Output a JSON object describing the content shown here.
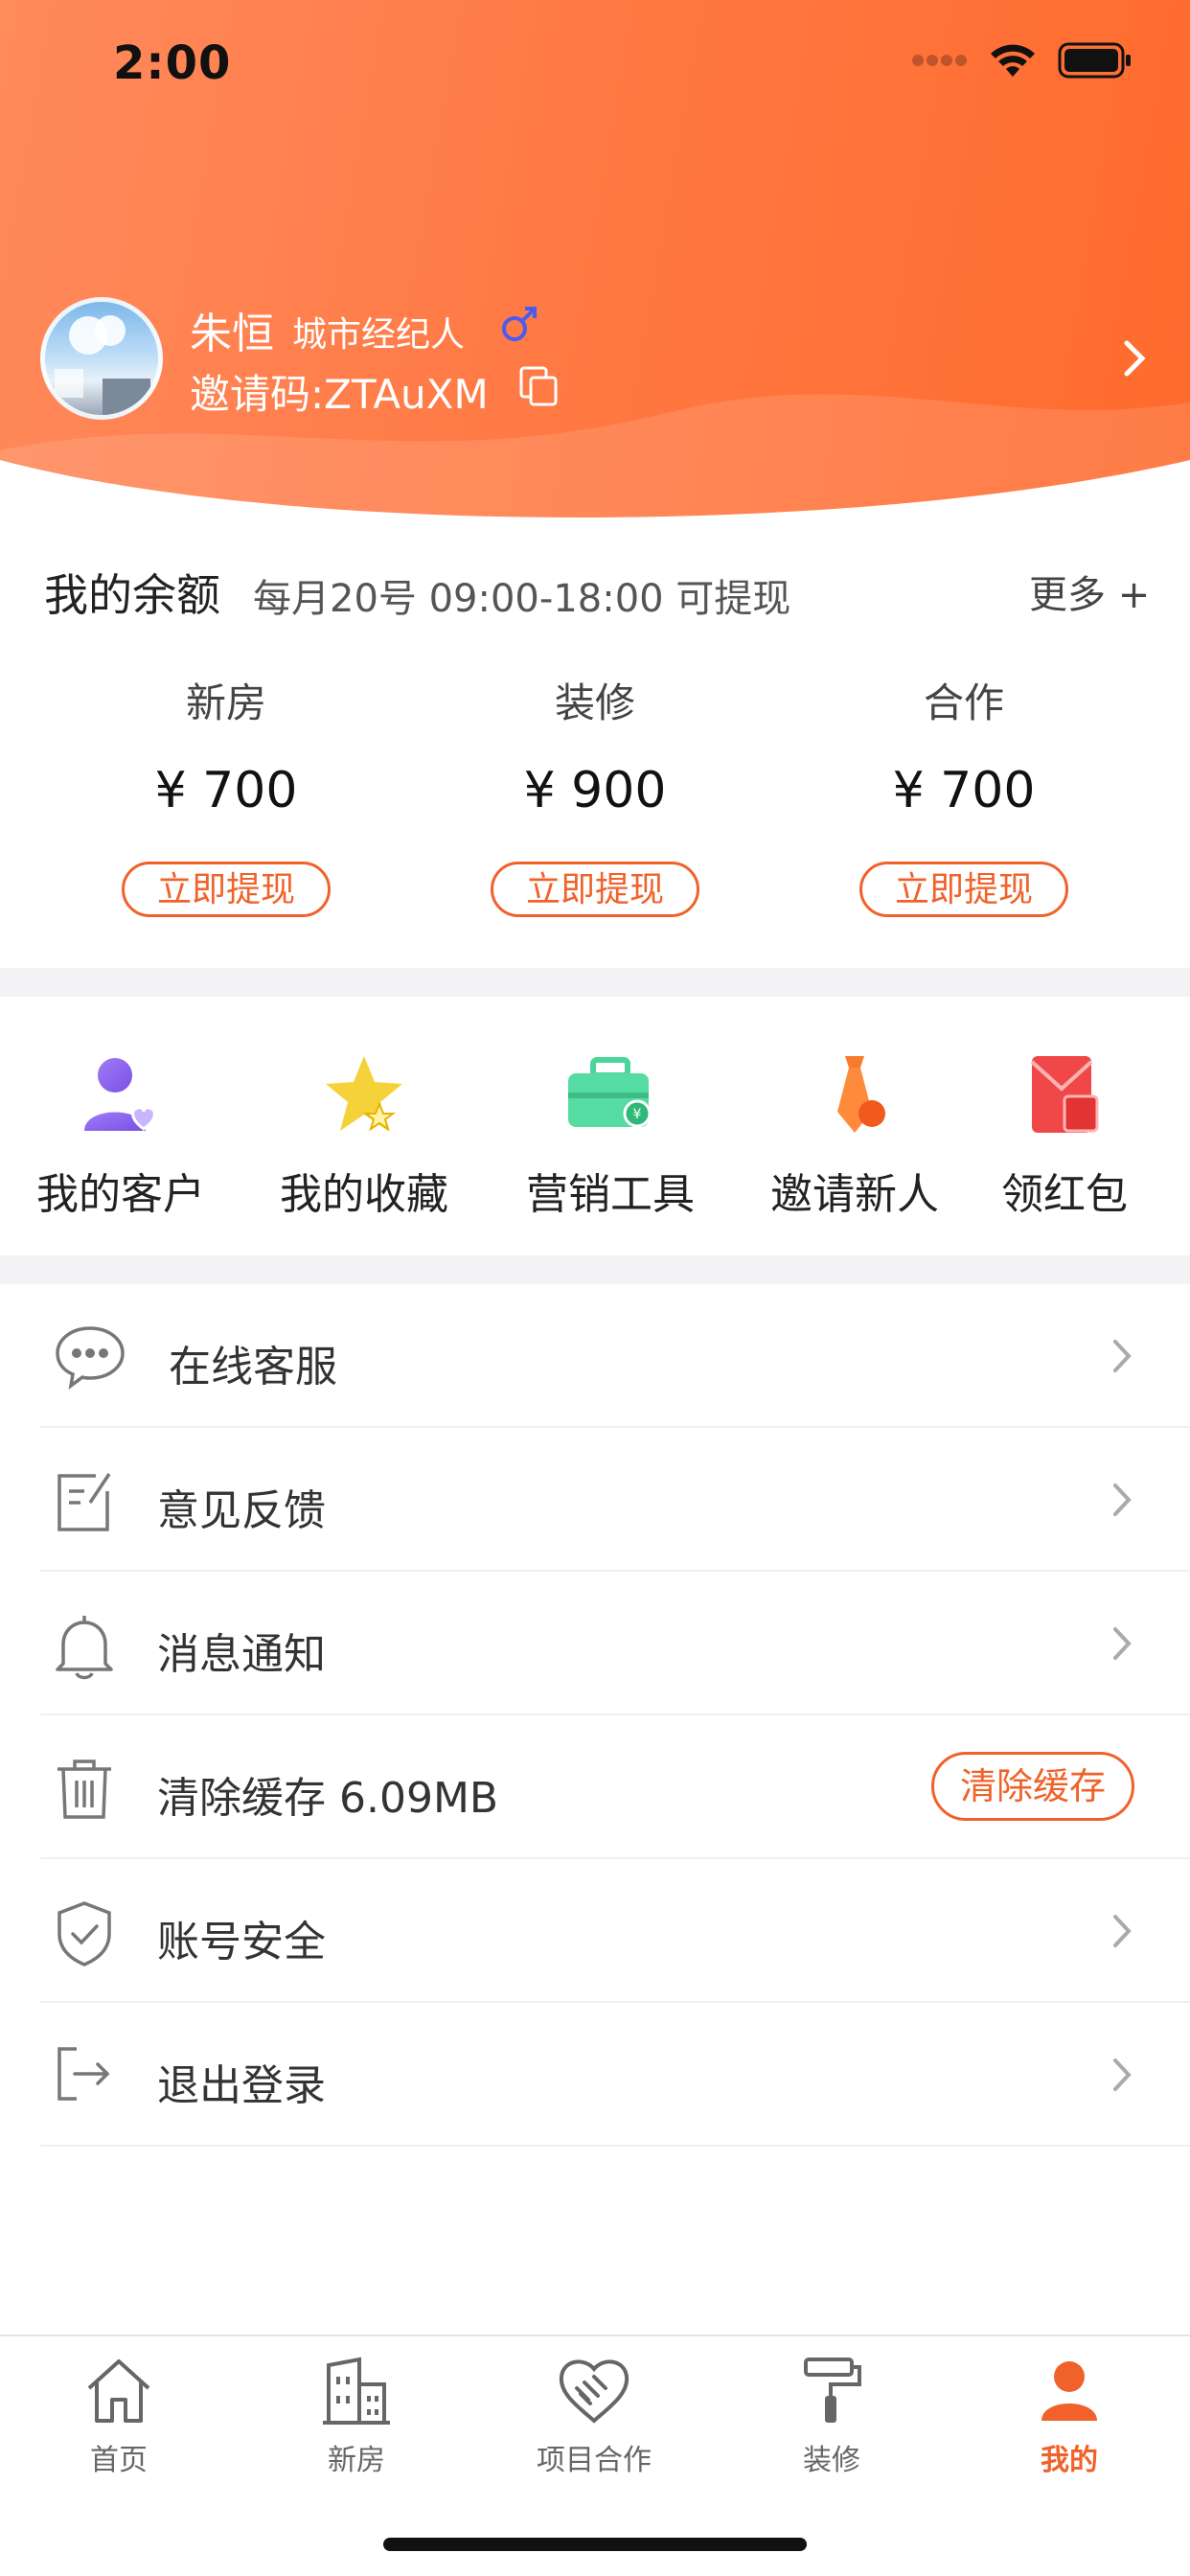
{
  "status_bar": {
    "time": "2:00"
  },
  "profile": {
    "name": "朱恒",
    "role": "城市经纪人",
    "gender_symbol": "♂",
    "invite_code": "邀请码:ZTAuXM"
  },
  "balance": {
    "title": "我的余额",
    "note": "每月20号 09:00-18:00 可提现",
    "more": "更多 +",
    "columns": [
      {
        "label": "新房",
        "amount": "¥ 700",
        "button": "立即提现"
      },
      {
        "label": "装修",
        "amount": "¥ 900",
        "button": "立即提现"
      },
      {
        "label": "合作",
        "amount": "¥ 700",
        "button": "立即提现"
      }
    ]
  },
  "quick_actions": [
    {
      "label": "我的客户",
      "icon": "customer-icon"
    },
    {
      "label": "我的收藏",
      "icon": "star-icon"
    },
    {
      "label": "营销工具",
      "icon": "briefcase-icon"
    },
    {
      "label": "邀请新人",
      "icon": "tie-icon"
    },
    {
      "label": "领红包",
      "icon": "red-packet-icon"
    }
  ],
  "menu": [
    {
      "label": "在线客服",
      "icon": "chat-bubble-icon"
    },
    {
      "label": "意见反馈",
      "icon": "feedback-edit-icon"
    },
    {
      "label": "消息通知",
      "icon": "bell-icon"
    },
    {
      "label": "清除缓存 6.09MB",
      "icon": "trash-icon",
      "action": "清除缓存"
    },
    {
      "label": "账号安全",
      "icon": "shield-check-icon"
    },
    {
      "label": "退出登录",
      "icon": "logout-icon"
    }
  ],
  "tabs": [
    {
      "label": "首页",
      "icon": "home-icon"
    },
    {
      "label": "新房",
      "icon": "building-icon"
    },
    {
      "label": "项目合作",
      "icon": "handshake-icon"
    },
    {
      "label": "装修",
      "icon": "paint-roller-icon"
    },
    {
      "label": "我的",
      "icon": "person-icon",
      "active": true
    }
  ],
  "colors": {
    "accent": "#f0622a",
    "header_start": "#ff8a5c",
    "header_end": "#ff6a2c"
  }
}
